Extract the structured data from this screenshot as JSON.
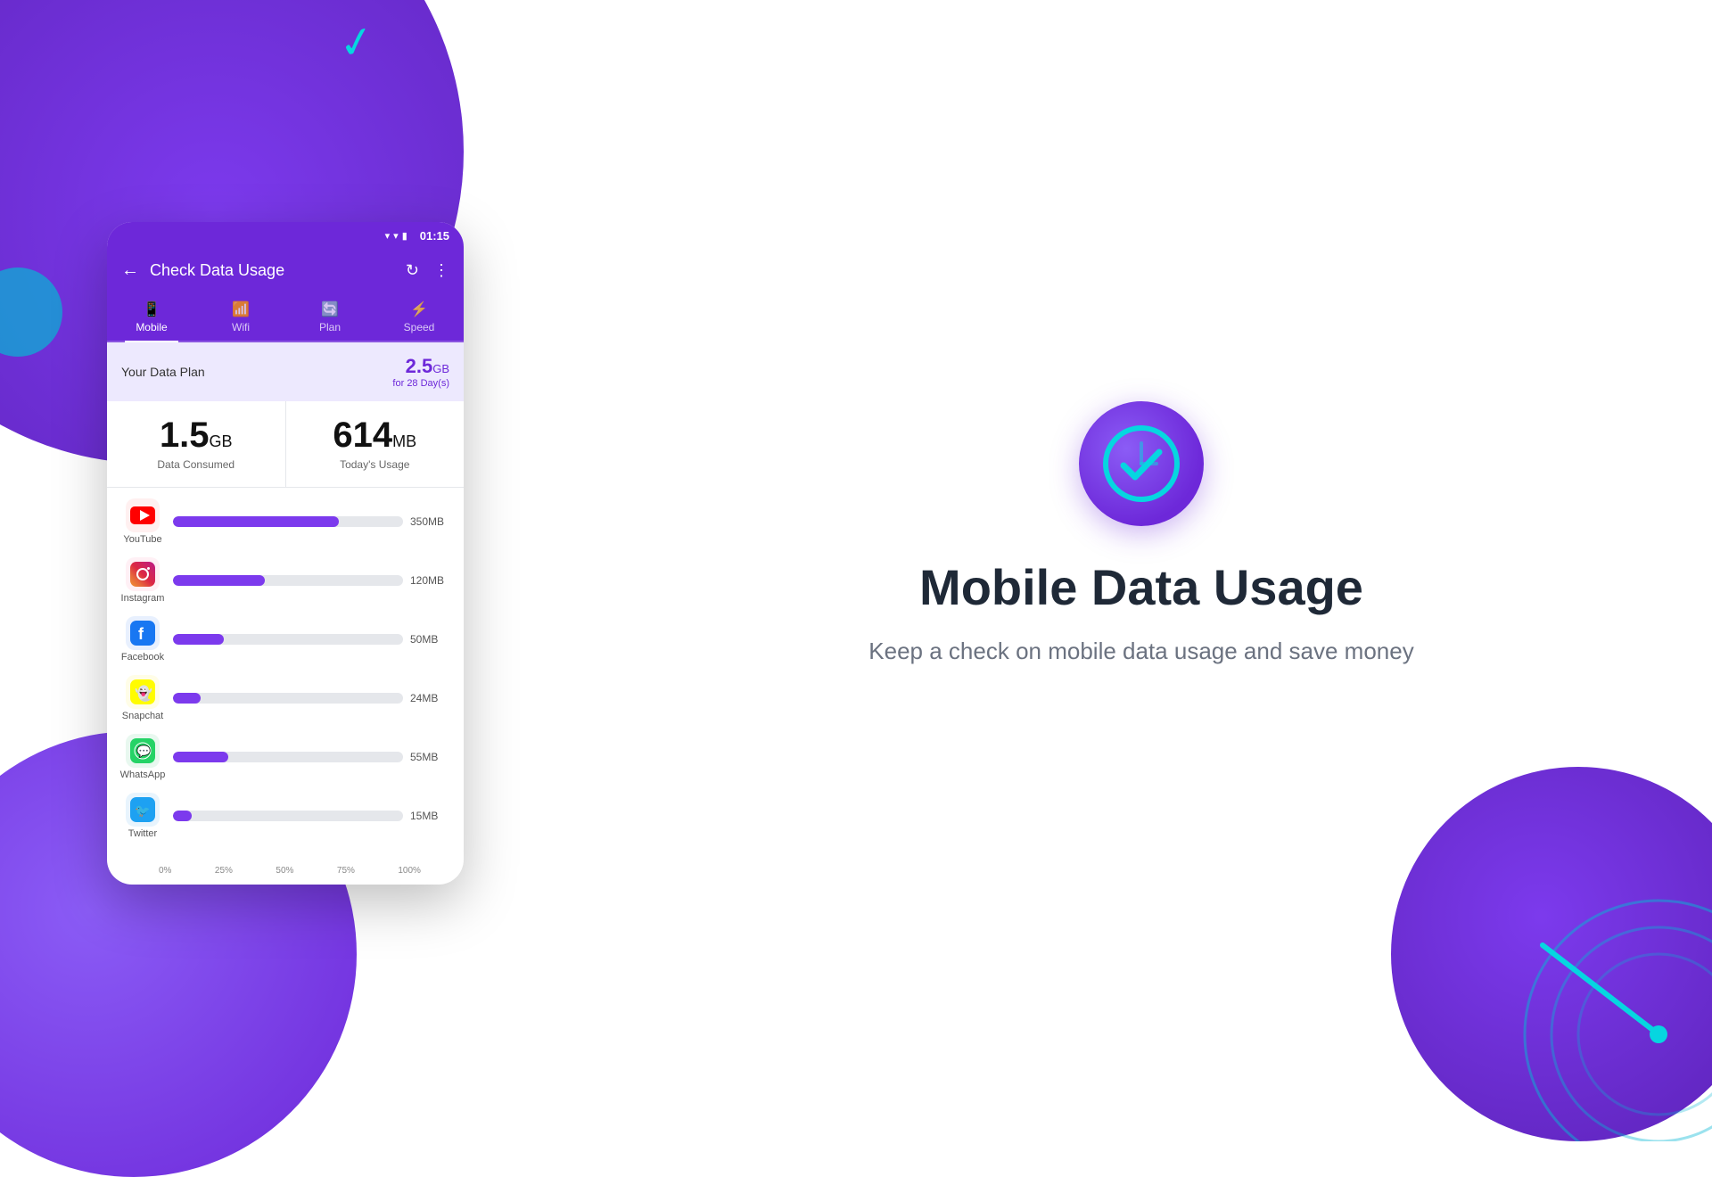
{
  "background": {
    "accent_color": "#6d28d9",
    "cyan_color": "#06b6d4"
  },
  "phone": {
    "status_bar": {
      "time": "01:15"
    },
    "header": {
      "title": "Check Data Usage",
      "back_icon": "←",
      "refresh_icon": "↻",
      "more_icon": "⋮"
    },
    "tabs": [
      {
        "label": "Mobile",
        "icon": "📱",
        "active": true
      },
      {
        "label": "Wifi",
        "icon": "📶",
        "active": false
      },
      {
        "label": "Plan",
        "icon": "🔄",
        "active": false
      },
      {
        "label": "Speed",
        "icon": "⚡",
        "active": false
      }
    ],
    "data_plan": {
      "label": "Your Data Plan",
      "value": "2.5",
      "unit": "GB",
      "period": "for 28 Day(s)"
    },
    "stats": [
      {
        "value": "1.5",
        "unit": "GB",
        "label": "Data Consumed"
      },
      {
        "value": "614",
        "unit": "MB",
        "label": "Today's Usage"
      }
    ],
    "apps": [
      {
        "name": "YouTube",
        "color": "#ff0000",
        "icon": "▶",
        "bg": "#fff0f0",
        "usage": "350MB",
        "percent": 72
      },
      {
        "name": "Instagram",
        "color": "#e1306c",
        "icon": "📷",
        "bg": "#fff0f5",
        "usage": "120MB",
        "percent": 40
      },
      {
        "name": "Facebook",
        "color": "#1877f2",
        "icon": "f",
        "bg": "#e8f0fe",
        "usage": "50MB",
        "percent": 22
      },
      {
        "name": "Snapchat",
        "color": "#fffc00",
        "icon": "👻",
        "bg": "#fffde7",
        "usage": "24MB",
        "percent": 12
      },
      {
        "name": "WhatsApp",
        "color": "#25d366",
        "icon": "💬",
        "bg": "#e8f8ef",
        "usage": "55MB",
        "percent": 24
      },
      {
        "name": "Twitter",
        "color": "#1da1f2",
        "icon": "🐦",
        "bg": "#e8f4fd",
        "usage": "15MB",
        "percent": 8
      }
    ],
    "x_axis": [
      "0%",
      "25%",
      "50%",
      "75%",
      "100%"
    ]
  },
  "right_panel": {
    "logo_alt": "Mobile Data Usage App Icon",
    "title": "Mobile Data Usage",
    "subtitle": "Keep a check on mobile data usage and save money"
  }
}
